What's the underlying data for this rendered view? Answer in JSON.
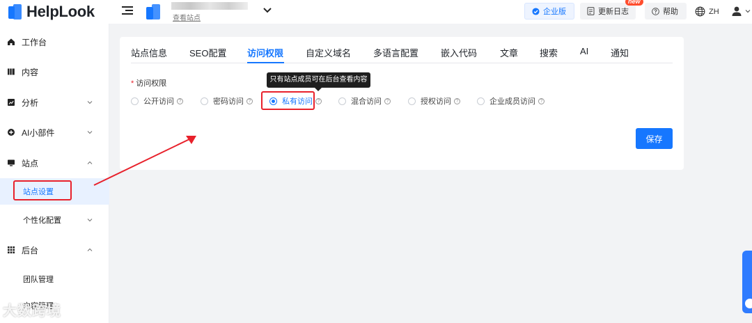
{
  "app": {
    "name": "HelpLook"
  },
  "header": {
    "site_view_link": "查看站点",
    "enterprise_label": "企业版",
    "changelog_label": "更新日志",
    "new_badge": "new",
    "help_label": "帮助",
    "lang_label": "ZH"
  },
  "sidebar": {
    "items": [
      {
        "label": "工作台"
      },
      {
        "label": "内容"
      },
      {
        "label": "分析"
      },
      {
        "label": "AI小部件"
      },
      {
        "label": "站点"
      },
      {
        "label": "站点设置"
      },
      {
        "label": "个性化配置"
      },
      {
        "label": "后台"
      },
      {
        "label": "团队管理"
      },
      {
        "label": "内容管理"
      }
    ]
  },
  "tabs": [
    "站点信息",
    "SEO配置",
    "访问权限",
    "自定义域名",
    "多语言配置",
    "嵌入代码",
    "文章",
    "搜索",
    "AI",
    "通知"
  ],
  "form": {
    "field_label": "访问权限",
    "options": [
      "公开访问",
      "密码访问",
      "私有访问",
      "混合访问",
      "授权访问",
      "企业成员访问"
    ],
    "selected": "私有访问",
    "tooltip": "只有站点成员可在后台查看内容",
    "save_label": "保存"
  },
  "watermark": "大数跨境",
  "colors": {
    "accent": "#1677ff",
    "highlight": "#e8212b"
  }
}
